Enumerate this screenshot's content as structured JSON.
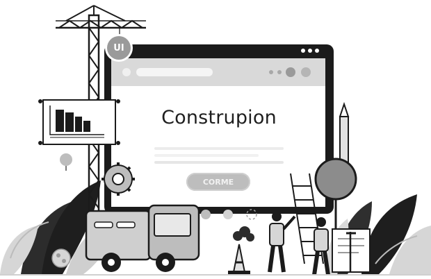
{
  "screen": {
    "heading": "Construpion",
    "button_label": "CORME"
  },
  "badge": {
    "label": "UI"
  },
  "colors": {
    "frame": "#1b1b1b",
    "screen_bg": "#ffffff",
    "browser_bar": "#d9d9d9",
    "button": "#bdbdbd",
    "leaf_dark": "#2c2c2c",
    "leaf_light": "#d6d6d6"
  }
}
